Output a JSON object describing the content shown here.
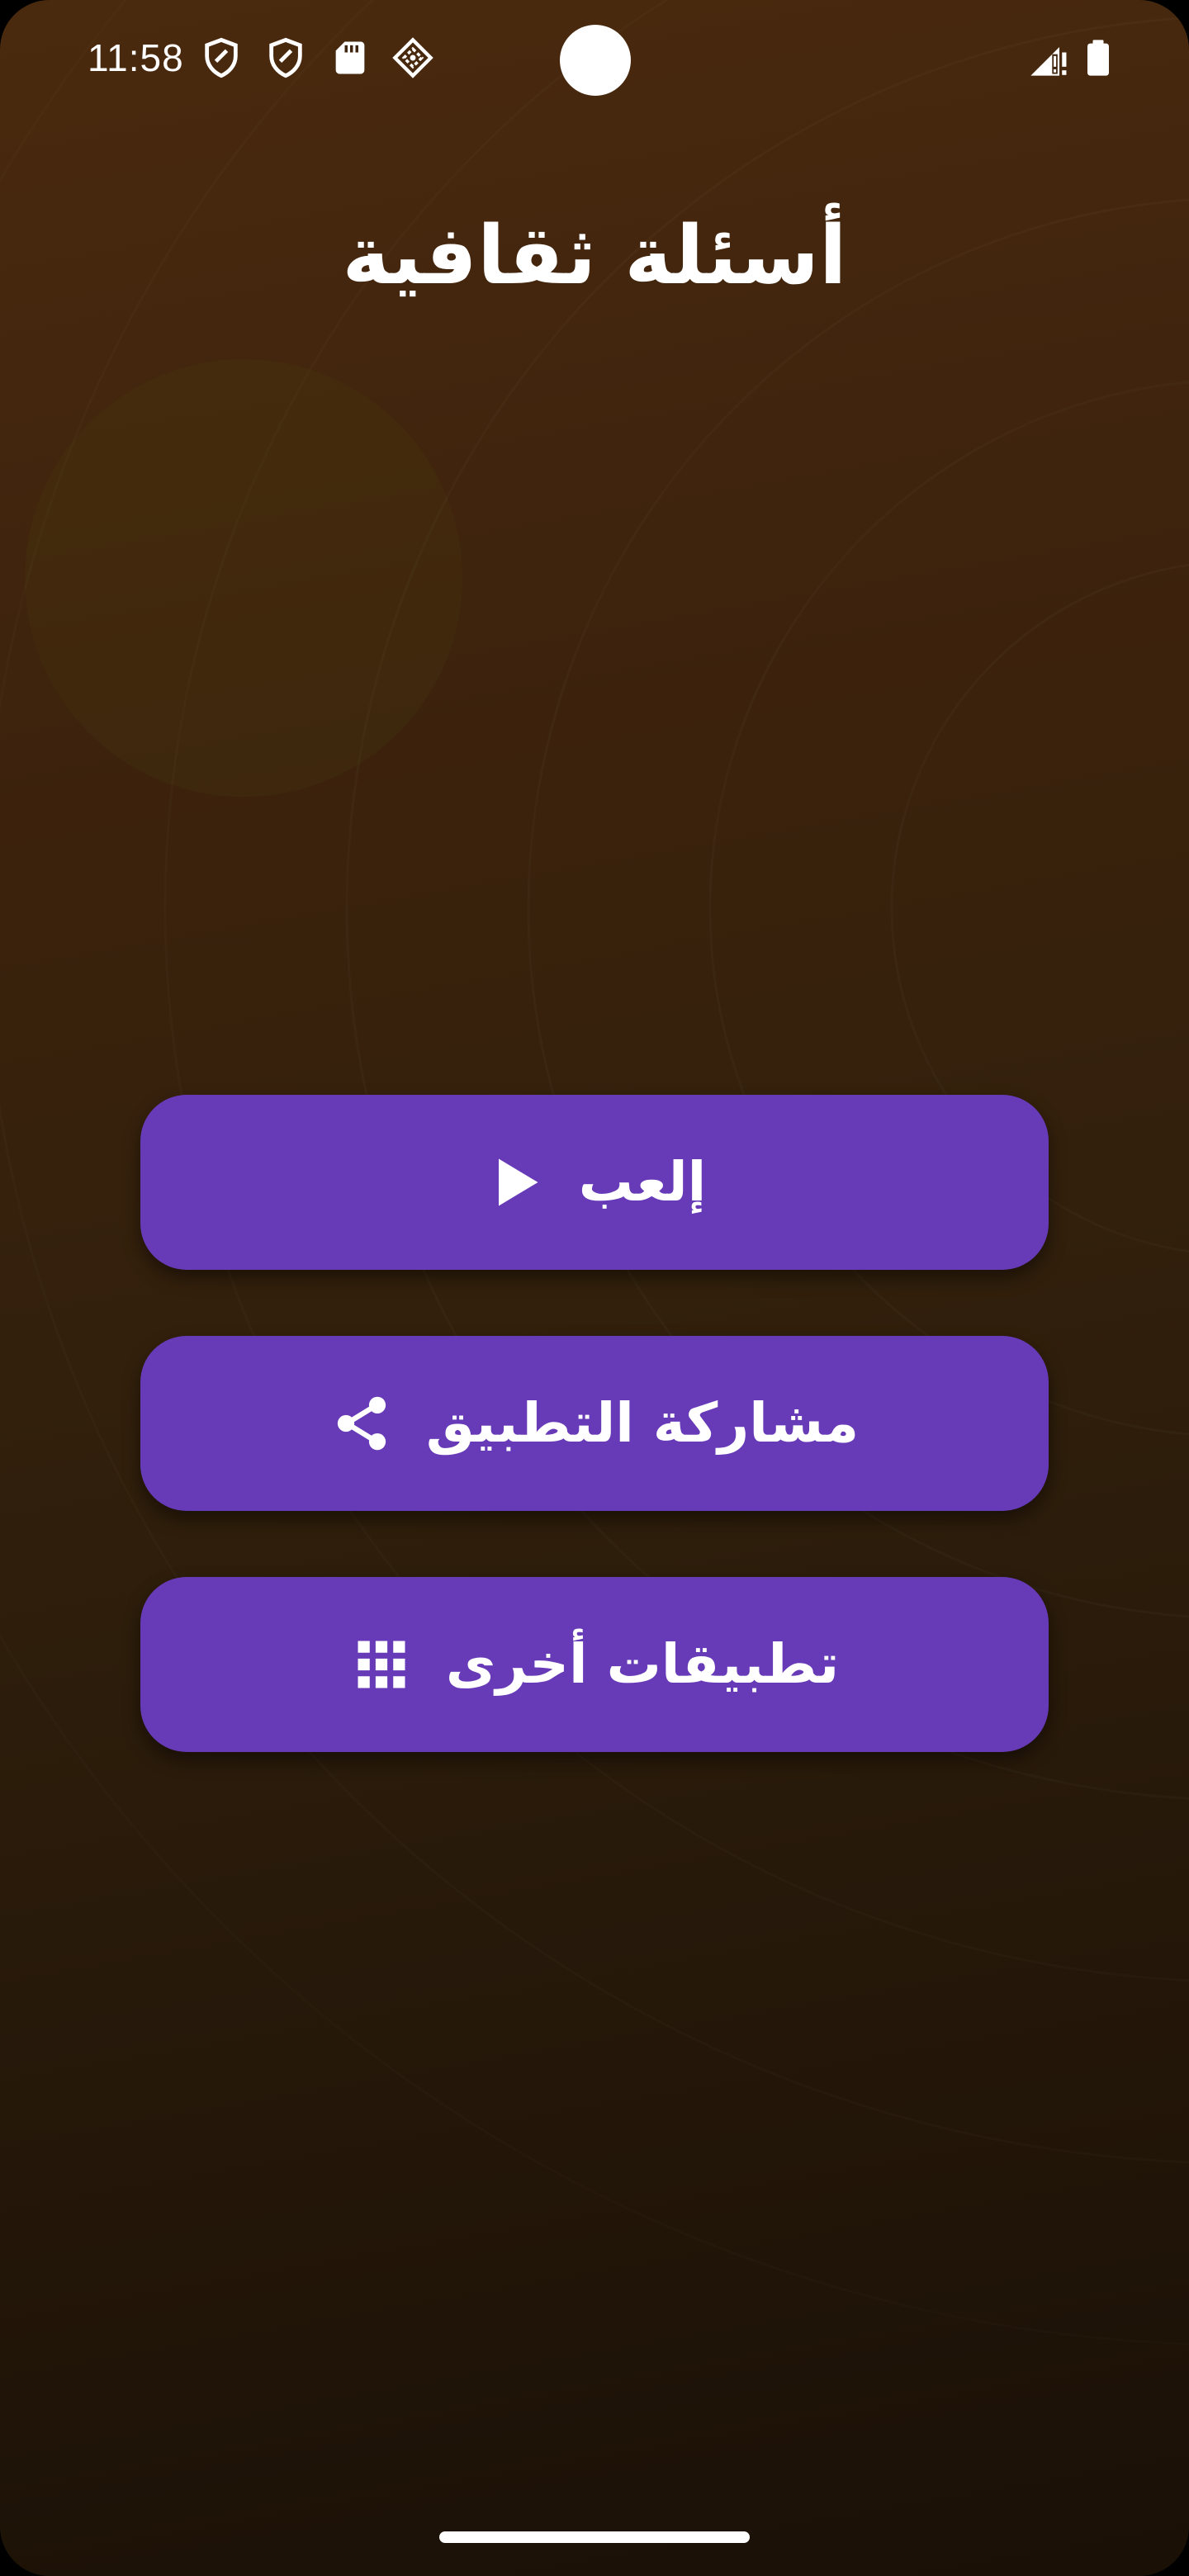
{
  "status_bar": {
    "time": "11:58",
    "left_icons": [
      "shield-icon",
      "shield-icon",
      "sd-card-icon",
      "location-diamond-icon"
    ],
    "right_icons": [
      "signal-alert-icon",
      "battery-icon"
    ]
  },
  "app": {
    "title": "أسئلة ثقافية"
  },
  "menu": {
    "play_label": "إلعب",
    "play_icon": "play-icon",
    "share_label": "مشاركة التطبيق",
    "share_icon": "share-icon",
    "more_label": "تطبيقات أخرى",
    "more_icon": "apps-grid-icon"
  },
  "colors": {
    "button": "#673ab7",
    "background_top": "#4a2a0e",
    "background_bottom": "#1a1006",
    "text": "#ffffff"
  }
}
